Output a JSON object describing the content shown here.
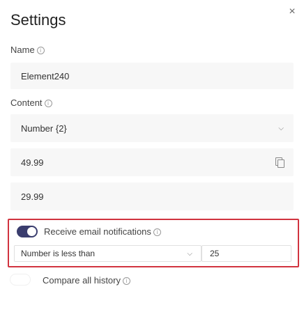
{
  "dialog": {
    "title": "Settings",
    "close_icon": "×"
  },
  "name": {
    "label": "Name",
    "value": "Element240"
  },
  "content": {
    "label": "Content",
    "selected": "Number {2}",
    "values": [
      "49.99",
      "29.99"
    ]
  },
  "email_notifications": {
    "enabled": true,
    "label": "Receive email notifications",
    "condition": "Number is less than",
    "threshold": "25"
  },
  "compare_history": {
    "enabled": false,
    "label": "Compare all history"
  },
  "icons": {
    "info": "ⓘ",
    "chevron": "⌄"
  },
  "colors": {
    "highlight_border": "#d1333f",
    "toggle_on": "#3a3d6e"
  }
}
